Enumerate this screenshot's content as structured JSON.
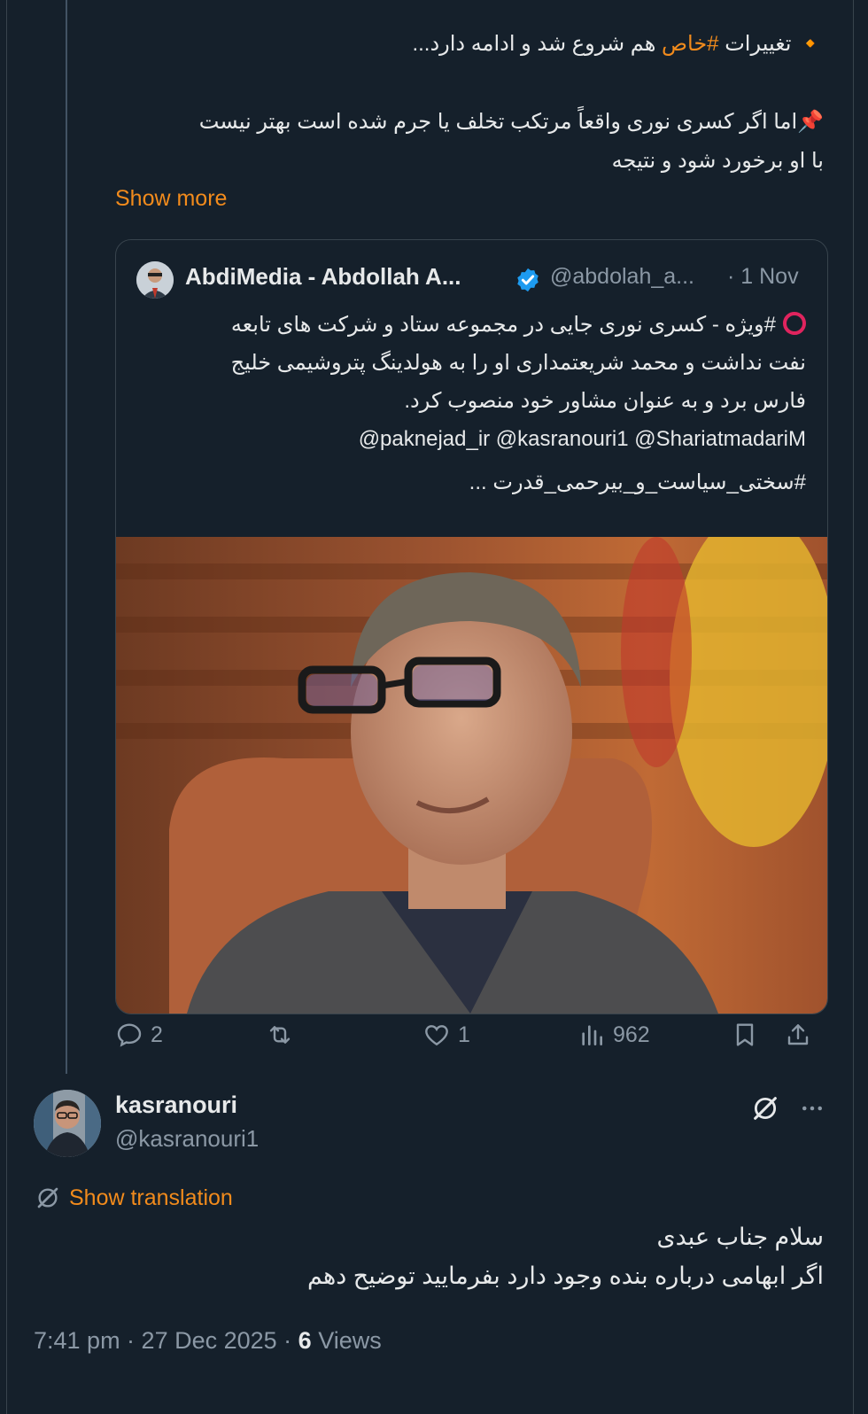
{
  "tweet": {
    "line1_pre": "🔸 تغییرات ",
    "line1_tag": "#خاص",
    "line1_post": " هم شروع شد و ادامه دارد...",
    "line2": "📌اما اگر کسری نوری واقعاً مرتکب تخلف یا جرم شده است بهتر نیست",
    "line3": "با او برخورد شود و نتیجه",
    "show_more": "Show more"
  },
  "quote": {
    "name": "AbdiMedia - Abdollah A...",
    "handle": "@abdolah_a...",
    "date": "· 1 Nov",
    "line1": "#ویژه - کسری نوری جایی در مجموعه ستاد و شرکت های تابعه",
    "line2": "نفت نداشت و محمد شریعتمداری او را به هولدینگ پتروشیمی خلیج",
    "line3": "فارس برد و به عنوان مشاور خود منصوب کرد.",
    "line4": "@paknejad_ir @kasranouri1 @ShariatmadariM",
    "line5": "#سختی_سیاست_و_بیرحمی_قدرت  ...",
    "verified_color": "#1d9bf0"
  },
  "actions": {
    "replies": "2",
    "likes": "1",
    "views": "962"
  },
  "reply": {
    "name": "kasranouri",
    "handle": "@kasranouri1",
    "show_translation": "Show translation",
    "line1": "سلام جناب عبدی",
    "line2": "اگر ابهامی درباره بنده وجود دارد بفرمایید توضیح دهم",
    "time": "7:41 pm · 27 Dec 2025 · ",
    "views_count": "6",
    "views_label": " Views"
  },
  "colors": {
    "background": "#15202b",
    "accent": "#f28b1c",
    "muted": "#8b98a5"
  }
}
